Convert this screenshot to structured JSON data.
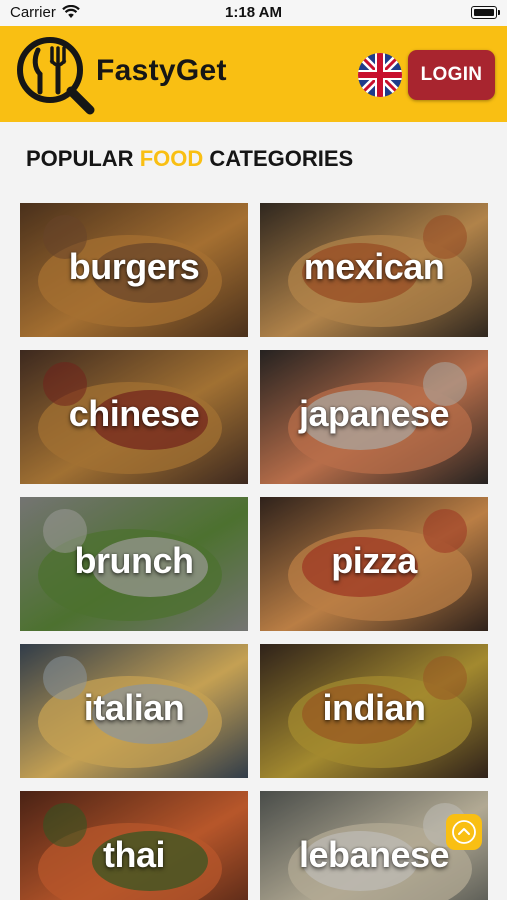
{
  "status_bar": {
    "carrier": "Carrier",
    "time": "1:18 AM"
  },
  "header": {
    "brand": "FastyGet",
    "login_label": "LOGIN"
  },
  "section": {
    "title_before": "POPULAR ",
    "title_accent": "FOOD",
    "title_after": " CATEGORIES"
  },
  "categories": [
    {
      "label": "burgers",
      "colors": [
        "#5a3b22",
        "#c9883c",
        "#7d5233"
      ]
    },
    {
      "label": "mexican",
      "colors": [
        "#3a3026",
        "#d8a05a",
        "#b85a2a"
      ]
    },
    {
      "label": "chinese",
      "colors": [
        "#4a3226",
        "#c58a3e",
        "#8a2a22"
      ]
    },
    {
      "label": "japanese",
      "colors": [
        "#2e2a28",
        "#e0865a",
        "#d0cfc8"
      ]
    },
    {
      "label": "brunch",
      "colors": [
        "#8e8e8c",
        "#5e8a3a",
        "#bdbcb8"
      ]
    },
    {
      "label": "pizza",
      "colors": [
        "#3a2a22",
        "#e39a54",
        "#c0402a"
      ]
    },
    {
      "label": "italian",
      "colors": [
        "#3c4a5a",
        "#f0c466",
        "#a9b6c0"
      ]
    },
    {
      "label": "indian",
      "colors": [
        "#3a2a20",
        "#c7a83a",
        "#b9692a"
      ]
    },
    {
      "label": "thai",
      "colors": [
        "#5a2a1a",
        "#e06a34",
        "#3a6a2a"
      ]
    },
    {
      "label": "lebanese",
      "colors": [
        "#5a5e5a",
        "#d9cfb4",
        "#e8e6df"
      ]
    }
  ],
  "colors": {
    "brand_yellow": "#f9bf13",
    "login_red": "#a8252f"
  },
  "icons": {
    "logo": "fork-knife-magnifier-icon",
    "language": "uk-flag-icon",
    "scroll_top": "chevron-up-icon"
  }
}
